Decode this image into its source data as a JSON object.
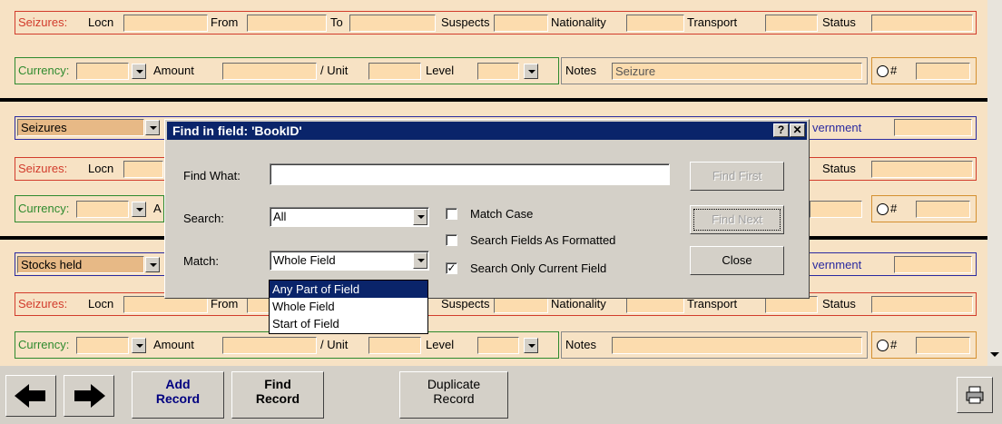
{
  "row1": {
    "seizures_label": "Seizures:",
    "locn_label": "Locn",
    "from_label": "From",
    "to_label": "To",
    "suspects_label": "Suspects",
    "nationality_label": "Nationality",
    "transport_label": "Transport",
    "status_label": "Status",
    "currency_label": "Currency:",
    "amount_label": "Amount",
    "unit_label": "/ Unit",
    "level_label": "Level",
    "notes_label": "Notes",
    "notes_value": "Seizure",
    "hash_label": "#"
  },
  "row2": {
    "category_value": "Seizures",
    "government_label": "vernment",
    "seizures_label": "Seizures:",
    "locn_label": "Locn",
    "status_label": "Status",
    "currency_label": "Currency:",
    "amount_label": "A",
    "hash_label": "#"
  },
  "row3": {
    "category_value": "Stocks held",
    "government_label": "vernment",
    "seizures_label": "Seizures:",
    "locn_label": "Locn",
    "from_label": "From",
    "suspects_label": "Suspects",
    "nationality_label": "Nationality",
    "transport_label": "Transport",
    "status_label": "Status",
    "currency_label": "Currency:",
    "amount_label": "Amount",
    "unit_label": "/ Unit",
    "level_label": "Level",
    "notes_label": "Notes",
    "hash_label": "#"
  },
  "dialog": {
    "title": "Find in field: 'BookID'",
    "help_btn": "?",
    "close_btn": "✕",
    "find_what_label": "Find What:",
    "find_what_value": "",
    "search_label": "Search:",
    "search_value": "All",
    "match_label": "Match:",
    "match_value": "Whole Field",
    "match_case": "Match Case",
    "search_formatted": "Search Fields As Formatted",
    "search_current": "Search Only Current Field",
    "find_first": "Find First",
    "find_next": "Find Next",
    "close": "Close",
    "match_options": [
      "Any Part of Field",
      "Whole Field",
      "Start of Field"
    ]
  },
  "toolbar": {
    "add_record": [
      "Add",
      "Record"
    ],
    "find_record": [
      "Find",
      "Record"
    ],
    "duplicate_record": [
      "Duplicate",
      "Record"
    ]
  }
}
